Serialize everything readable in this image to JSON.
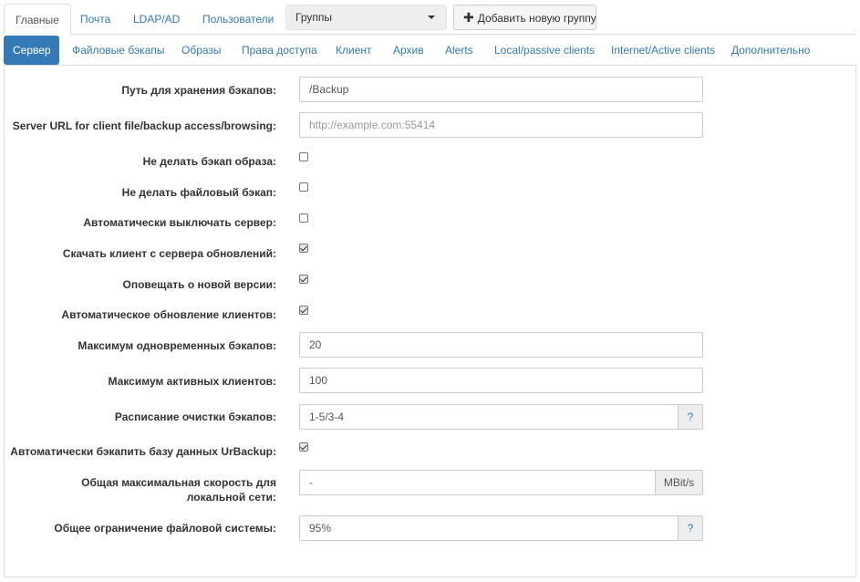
{
  "top_tabs": [
    "Главные",
    "Почта",
    "LDAP/AD",
    "Пользователи"
  ],
  "group_select": {
    "value": "Группы"
  },
  "add_group_button": "Добавить новую группу",
  "sub_tabs": [
    "Сервер",
    "Файловые бэкапы",
    "Образы",
    "Права доступа",
    "Клиент",
    "Архив",
    "Alerts",
    "Local/passive clients",
    "Internet/Active clients",
    "Дополнительно"
  ],
  "fields": {
    "backup_path": {
      "label": "Путь для хранения бэкапов:",
      "value": "/Backup"
    },
    "server_url": {
      "label": "Server URL for client file/backup access/browsing:",
      "placeholder": "http://example.com:55414"
    },
    "no_image_backup": {
      "label": "Не делать бэкап образа:",
      "checked": false
    },
    "no_file_backup": {
      "label": "Не делать файловый бэкап:",
      "checked": false
    },
    "auto_shutdown": {
      "label": "Автоматически выключать сервер:",
      "checked": false
    },
    "download_client": {
      "label": "Скачать клиент с сервера обновлений:",
      "checked": true
    },
    "notify_new_version": {
      "label": "Оповещать о новой версии:",
      "checked": true
    },
    "auto_update_clients": {
      "label": "Автоматическое обновление клиентов:",
      "checked": true
    },
    "max_simultaneous_backups": {
      "label": "Максимум одновременных бэкапов:",
      "value": "20"
    },
    "max_active_clients": {
      "label": "Максимум активных клиентов:",
      "value": "100"
    },
    "cleanup_schedule": {
      "label": "Расписание очистки бэкапов:",
      "value": "1-5/3-4",
      "addon": "?"
    },
    "auto_backup_database": {
      "label": "Автоматически бэкапить базу данных UrBackup:",
      "checked": true
    },
    "max_local_speed": {
      "label": "Общая максимальная скорость для локальной сети:",
      "value": "-",
      "unit": "MBit/s"
    },
    "fs_limit": {
      "label": "Общее ограничение файловой системы:",
      "value": "95%",
      "addon": "?"
    }
  }
}
